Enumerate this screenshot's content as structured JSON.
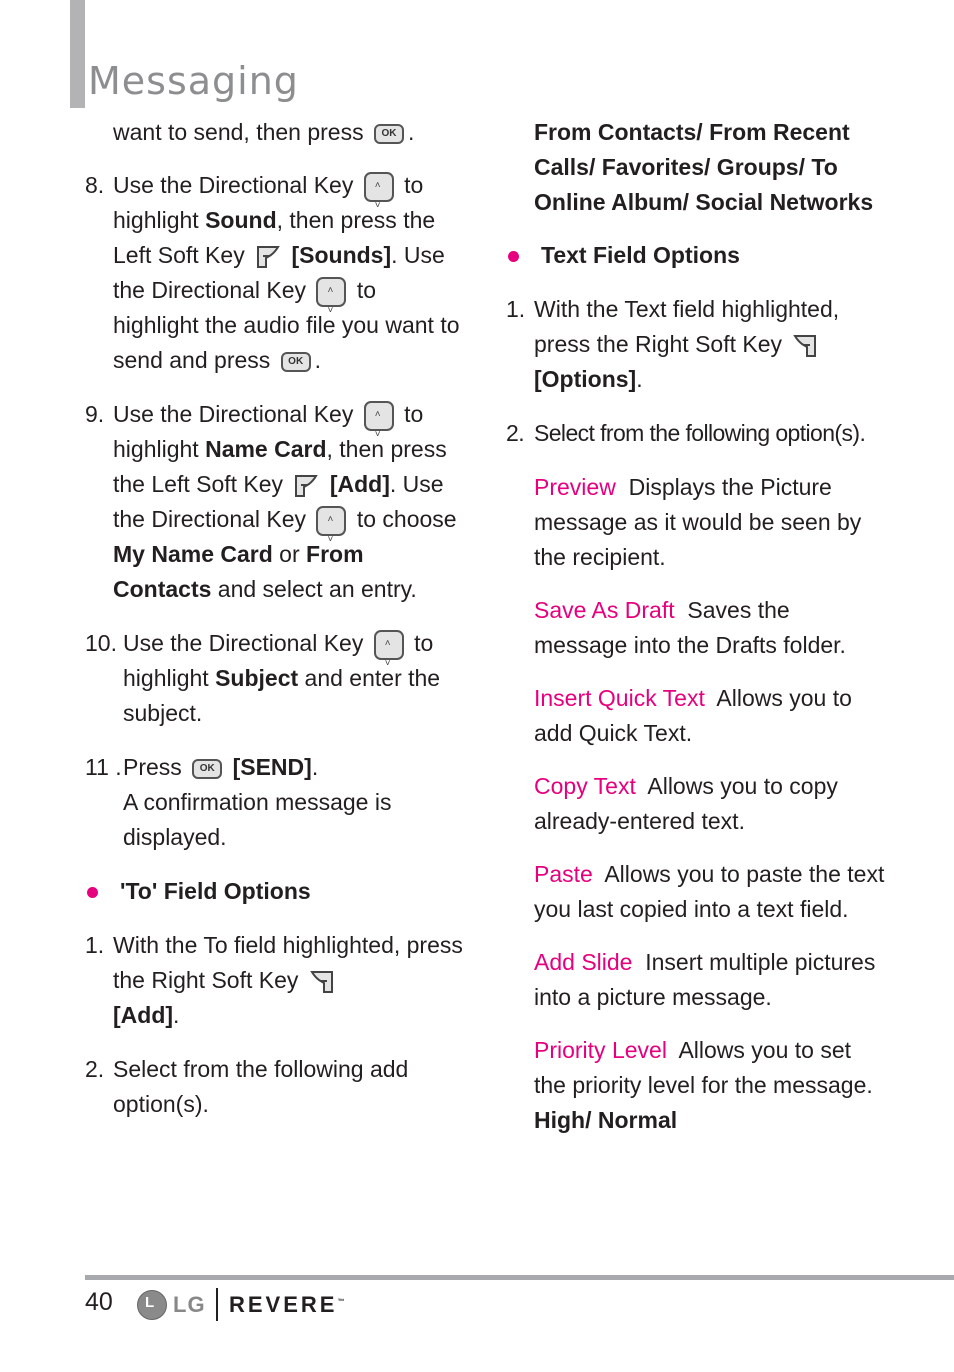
{
  "header": {
    "title": "Messaging"
  },
  "left": {
    "intro": {
      "a": "want to send, then press",
      "b": "."
    },
    "step8": {
      "num": "8.",
      "t1": "Use the Directional Key",
      "t2": "to highlight",
      "bold1": "Sound",
      "t3": ", then press the Left Soft Key",
      "bold2": "[Sounds]",
      "t4": ". Use the Directional Key",
      "t5": "to highlight the audio file you want to send and press",
      "t6": "."
    },
    "step9": {
      "num": "9.",
      "t1": "Use the Directional Key",
      "t2": "to highlight",
      "bold1": "Name Card",
      "t3": ", then press the Left Soft  Key",
      "bold2": "[Add]",
      "t4": ". Use the Directional Key",
      "t5": "to choose",
      "bold3": "My Name Card",
      "t6": "or",
      "bold4": "From Contacts",
      "t7": "and select an entry."
    },
    "step10": {
      "num": "10.",
      "t1": "Use the Directional Key",
      "t2": "to highlight",
      "bold1": "Subject",
      "t3": "and enter the subject."
    },
    "step11": {
      "num": "11 .",
      "t1": "Press",
      "bold1": "[SEND]",
      "t2": ".",
      "t3": "A confirmation message is displayed."
    },
    "to_options": {
      "heading": "'To' Field Options",
      "step1": {
        "num": "1.",
        "t1": "With the To field highlighted, press the Right Soft Key",
        "bold1": "[Add]",
        "t2": "."
      },
      "step2": {
        "num": "2.",
        "t1": "Select from the following add option(s)."
      }
    }
  },
  "right": {
    "add_options": "From Contacts/ From Recent Calls/ Favorites/ Groups/ To Online Album/ Social Networks",
    "text_options": {
      "heading": "Text Field Options",
      "step1": {
        "num": "1.",
        "t1": "With the Text field highlighted, press the Right Soft Key",
        "bold1": "[Options]",
        "t2": "."
      },
      "step2": {
        "num": "2.",
        "t1": "Select from the following option(s)."
      },
      "options": [
        {
          "name": "Preview",
          "desc": "Displays the Picture message as it would be seen by the recipient."
        },
        {
          "name": "Save As Draft",
          "desc": "Saves the message into the Drafts folder."
        },
        {
          "name": "Insert Quick Text",
          "desc": "Allows you to add Quick Text."
        },
        {
          "name": "Copy Text",
          "desc": "Allows you to copy already-entered text."
        },
        {
          "name": "Paste",
          "desc": "Allows you to paste the text you last copied into a text field."
        },
        {
          "name": "Add Slide",
          "desc": "Insert multiple pictures into a picture message."
        },
        {
          "name": "Priority Level",
          "desc": "Allows you to set the priority level for the message."
        }
      ],
      "priority_values": "High/ Normal"
    }
  },
  "icons": {
    "ok_label": "OK"
  },
  "footer": {
    "page_number": "40",
    "logo_text": "LG",
    "logo_letter": "L",
    "brand": "REVERE",
    "tm": "™"
  },
  "colors": {
    "accent": "#e6007e",
    "title_gray": "#8c8e90",
    "bar_gray": "#b3b3b5"
  }
}
